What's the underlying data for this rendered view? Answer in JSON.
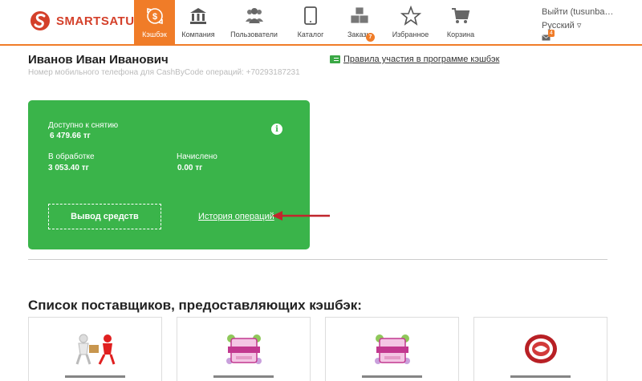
{
  "brand": {
    "name": "SMARTSATU",
    "logo_icon": "smartsatu-s-logo-icon",
    "accent": "#f07c28",
    "brand_red": "#d4402a"
  },
  "nav": [
    {
      "label": "Кэшбэк",
      "icon": "cashback-icon",
      "active": true
    },
    {
      "label": "Компания",
      "icon": "bank-icon"
    },
    {
      "label": "Пользователи",
      "icon": "users-icon"
    },
    {
      "label": "Каталог",
      "icon": "tablet-icon"
    },
    {
      "label": "Заказы",
      "icon": "boxes-icon",
      "badge": "7"
    },
    {
      "label": "Избранное",
      "icon": "star-icon"
    },
    {
      "label": "Корзина",
      "icon": "cart-icon"
    }
  ],
  "user_box": {
    "logout": "Выйти (tusunba…",
    "language": "Русский ▿",
    "mail_badge": "4"
  },
  "profile": {
    "name": "Иванов Иван Иванович",
    "phone_line": "Номер мобильного телефона для CashByCode операций: +70293187231",
    "rules_link": "Правила участия в программе кэшбэк"
  },
  "card": {
    "color": "#3ab44a",
    "available_label": "Доступно к снятию",
    "available_value": "6 479.66 тг",
    "processing_label": "В обработке",
    "processing_value": "3 053.40 тг",
    "accrued_label": "Начислено",
    "accrued_value": "0.00 тг",
    "info": "i",
    "withdraw": "Вывод средств",
    "history": "История операций"
  },
  "annotation_color": "#c0262d",
  "suppliers_title": "Список поставщиков, предоставляющих кэшбэк:",
  "suppliers": [
    {
      "logo": "delivery-man-logo"
    },
    {
      "logo": "pink-label-logo"
    },
    {
      "logo": "pink-label-logo"
    },
    {
      "logo": "red-seal-logo"
    }
  ]
}
